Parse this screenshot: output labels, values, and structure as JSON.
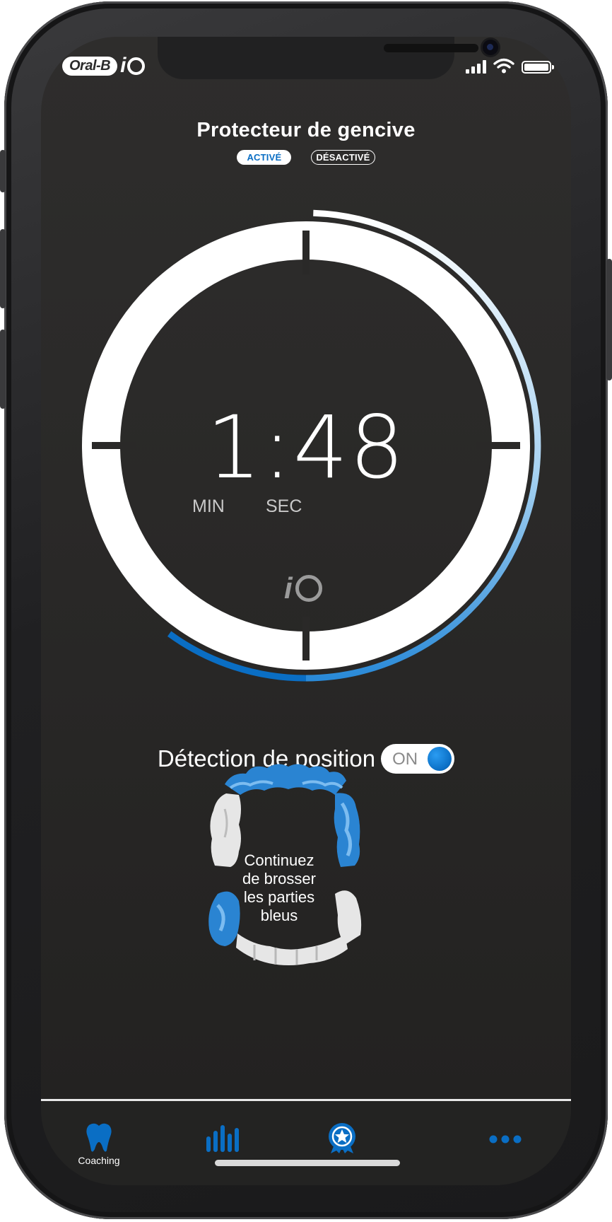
{
  "brand": {
    "logo_text": "Oral-B",
    "product_text": "i",
    "logo_icon": "oral-b-io-logo"
  },
  "status_bar": {
    "icons": [
      "signal-bars-icon",
      "wifi-icon",
      "battery-icon"
    ]
  },
  "header": {
    "title": "Protecteur de gencive",
    "modes": [
      {
        "label": "ACTIVÉ",
        "selected": true
      },
      {
        "label": "DÉSACTIVÉ",
        "selected": false
      }
    ]
  },
  "timer": {
    "display": "1:48",
    "min_label": "MIN",
    "sec_label": "SEC",
    "progress_fraction": 0.6,
    "watermark_text": "i",
    "accent_color": "#0a6ec4",
    "light_accent_color": "#e8f4fc"
  },
  "position_detection": {
    "label": "Détection de position",
    "toggle_label": "ON",
    "enabled": true
  },
  "mouth_map": {
    "message": "Continuez de brosser les parties bleus",
    "highlight_color": "#2a84d2",
    "done_color": "#e6e6e6"
  },
  "tabbar": {
    "tabs": [
      {
        "label": "Coaching",
        "icon": "tooth-icon",
        "selected": true
      },
      {
        "label": "",
        "icon": "stats-bars-icon",
        "selected": false
      },
      {
        "label": "",
        "icon": "award-badge-icon",
        "selected": false
      },
      {
        "label": "",
        "icon": "more-dots-icon",
        "selected": false
      }
    ]
  }
}
